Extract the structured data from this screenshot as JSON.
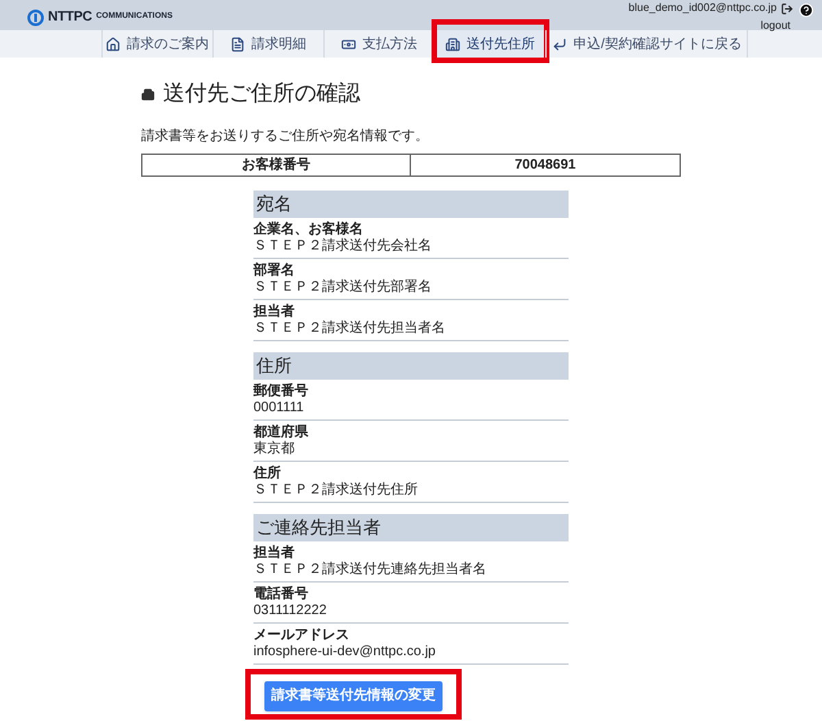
{
  "header": {
    "logo": {
      "brand": "NTTPC",
      "sub": "COMMUNICATIONS"
    },
    "user_email": "blue_demo_id002@nttpc.co.jp",
    "logout_label": "logout"
  },
  "nav": [
    {
      "kind": "tab",
      "label": "請求のご案内",
      "selected": false
    },
    {
      "kind": "tab",
      "label": "請求明細",
      "selected": false
    },
    {
      "kind": "tab",
      "label": "支払方法",
      "selected": false
    },
    {
      "kind": "tab",
      "label": "送付先住所",
      "selected": true,
      "highlighted": true
    },
    {
      "kind": "back-link",
      "label": "申込/契約確認サイトに戻る",
      "selected": false
    }
  ],
  "page": {
    "title": "送付先ご住所の確認",
    "description": "請求書等をお送りするご住所や宛名情報です。"
  },
  "customer_table": {
    "label": "お客様番号",
    "value": "70048691"
  },
  "sections": [
    {
      "title": "宛名",
      "fields": [
        {
          "label": "企業名、お客様名",
          "value": "ＳＴＥＰ２請求送付先会社名"
        },
        {
          "label": "部署名",
          "value": "ＳＴＥＰ２請求送付先部署名"
        },
        {
          "label": "担当者",
          "value": "ＳＴＥＰ２請求送付先担当者名"
        }
      ]
    },
    {
      "title": "住所",
      "fields": [
        {
          "label": "郵便番号",
          "value": "0001111"
        },
        {
          "label": "都道府県",
          "value": "東京都"
        },
        {
          "label": "住所",
          "value": "ＳＴＥＰ２請求送付先住所"
        }
      ]
    },
    {
      "title": "ご連絡先担当者",
      "fields": [
        {
          "label": "担当者",
          "value": "ＳＴＥＰ２請求送付先連絡先担当者名"
        },
        {
          "label": "電話番号",
          "value": "0311112222"
        },
        {
          "label": "メールアドレス",
          "value": "infosphere-ui-dev@nttpc.co.jp"
        }
      ]
    }
  ],
  "action_button": {
    "label": "請求書等送付先情報の変更",
    "highlighted": true
  }
}
